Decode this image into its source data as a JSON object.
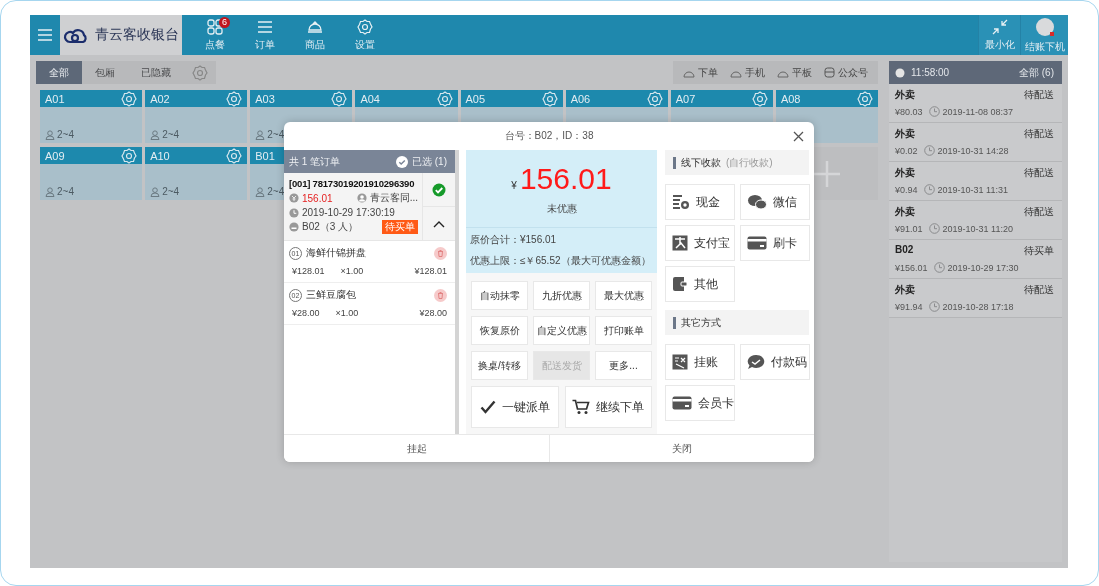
{
  "header": {
    "brand": "青云客收银台",
    "nav": [
      {
        "label": "点餐",
        "badge": "6"
      },
      {
        "label": "订单"
      },
      {
        "label": "商品"
      },
      {
        "label": "设置"
      }
    ],
    "actions": [
      {
        "label": "最小化"
      },
      {
        "label": "结账下机"
      }
    ]
  },
  "filter_tabs": [
    {
      "label": "全部",
      "selected": true
    },
    {
      "label": "包厢",
      "selected": false
    },
    {
      "label": "已隐藏",
      "selected": false
    }
  ],
  "sources": [
    {
      "label": "下单"
    },
    {
      "label": "手机"
    },
    {
      "label": "平板"
    },
    {
      "label": "公众号"
    }
  ],
  "tables": [
    {
      "name": "A01",
      "seats": "2~4",
      "settings": true
    },
    {
      "name": "A02",
      "seats": "2~4",
      "settings": true
    },
    {
      "name": "A03",
      "seats": "2~4",
      "settings": true
    },
    {
      "name": "A04",
      "settings": true
    },
    {
      "name": "A05",
      "settings": true
    },
    {
      "name": "A06",
      "settings": true
    },
    {
      "name": "A07",
      "settings": true
    },
    {
      "name": "A08",
      "settings": true
    },
    {
      "name": "A09",
      "seats": "2~4",
      "settings": true
    },
    {
      "name": "A10",
      "seats": "2~4",
      "settings": true
    },
    {
      "name": "B01",
      "seats": "2~4"
    }
  ],
  "orders_panel": {
    "time": "11:58:00",
    "filter": "全部 (6)",
    "orders": [
      {
        "name": "外卖",
        "status": "待配送",
        "amount": "¥80.03",
        "time": "2019-11-08 08:37"
      },
      {
        "name": "外卖",
        "status": "待配送",
        "amount": "¥0.02",
        "time": "2019-10-31 14:28"
      },
      {
        "name": "外卖",
        "status": "待配送",
        "amount": "¥0.94",
        "time": "2019-10-31 11:31"
      },
      {
        "name": "外卖",
        "status": "待配送",
        "amount": "¥91.01",
        "time": "2019-10-31 11:20"
      },
      {
        "name": "B02",
        "status": "待买单",
        "amount": "¥156.01",
        "time": "2019-10-29 17:30"
      },
      {
        "name": "外卖",
        "status": "待配送",
        "amount": "¥91.94",
        "time": "2019-10-28 17:18"
      }
    ]
  },
  "modal": {
    "title": "台号：B02，ID：38",
    "orders_header": {
      "count": "共 1 笔订单",
      "selected": "已选 (1)"
    },
    "order": {
      "number": "[001] 78173019201910296390",
      "amount": "156.01",
      "cashier": "青云客同...",
      "time": "2019-10-29 17:30:19",
      "table": "B02（3 人）",
      "status": "待买单",
      "checked": true,
      "expanded": true
    },
    "items": [
      {
        "index": "01",
        "name": "海鲜什锦拼盘",
        "price": "¥128.01",
        "qty": "×1.00",
        "total": "¥128.01"
      },
      {
        "index": "02",
        "name": "三鲜豆腐包",
        "price": "¥28.00",
        "qty": "×1.00",
        "total": "¥28.00"
      }
    ],
    "currency": "¥",
    "total": "156.01",
    "discount_note": "未优惠",
    "original_total": "原价合计：¥156.01",
    "discount_limit": "优惠上限：≤￥65.52（最大可优惠金额）",
    "actions": [
      {
        "label": "自动抹零",
        "disabled": false
      },
      {
        "label": "九折优惠",
        "disabled": false
      },
      {
        "label": "最大优惠",
        "disabled": false
      },
      {
        "label": "恢复原价",
        "disabled": false
      },
      {
        "label": "自定义优惠",
        "disabled": false
      },
      {
        "label": "打印账单",
        "disabled": false
      },
      {
        "label": "换桌/转移",
        "disabled": false
      },
      {
        "label": "配送发货",
        "disabled": true
      },
      {
        "label": "更多...",
        "disabled": false
      }
    ],
    "big_actions": [
      {
        "label": "一键派单"
      },
      {
        "label": "继续下单"
      }
    ],
    "pay_sections": [
      {
        "title": "线下收款",
        "note": "(自行收款)",
        "methods": [
          {
            "label": "现金"
          },
          {
            "label": "微信"
          },
          {
            "label": "支付宝"
          },
          {
            "label": "刷卡"
          },
          {
            "label": "其他"
          }
        ]
      },
      {
        "title": "其它方式",
        "methods": [
          {
            "label": "挂账"
          },
          {
            "label": "付款码"
          },
          {
            "label": "会员卡"
          }
        ]
      }
    ],
    "footer": [
      {
        "label": "挂起"
      },
      {
        "label": "关闭"
      }
    ]
  }
}
